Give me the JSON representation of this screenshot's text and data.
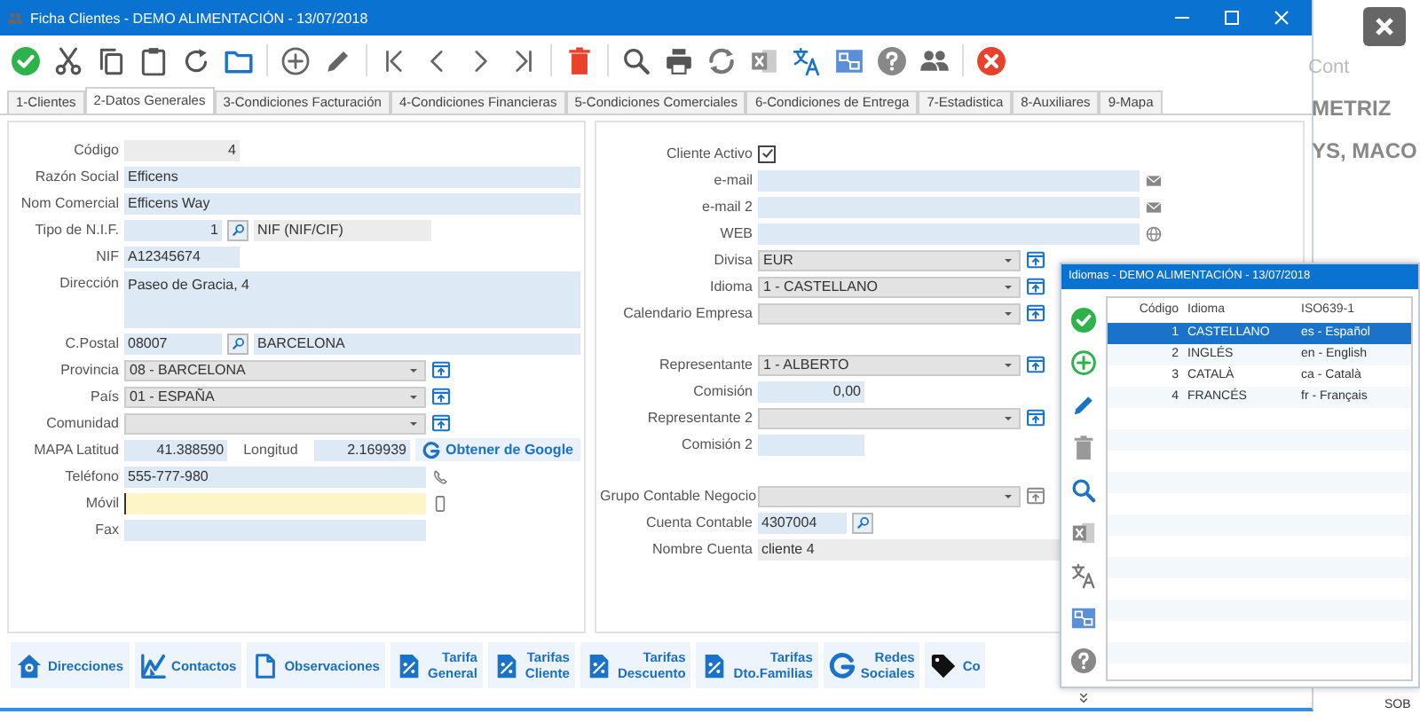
{
  "window": {
    "title": "Ficha Clientes - DEMO ALIMENTACIÓN - 13/07/2018"
  },
  "tabs": [
    {
      "label": "1-Clientes",
      "selected": false
    },
    {
      "label": "2-Datos Generales",
      "selected": true
    },
    {
      "label": "3-Condiciones Facturación",
      "selected": false
    },
    {
      "label": "4-Condiciones Financieras",
      "selected": false
    },
    {
      "label": "5-Condiciones Comerciales",
      "selected": false
    },
    {
      "label": "6-Condiciones de Entrega",
      "selected": false
    },
    {
      "label": "7-Estadistica",
      "selected": false
    },
    {
      "label": "8-Auxiliares",
      "selected": false
    },
    {
      "label": "9-Mapa",
      "selected": false
    }
  ],
  "general": {
    "codigo": {
      "label": "Código",
      "value": "4"
    },
    "razon_social": {
      "label": "Razón Social",
      "value": "Efficens"
    },
    "nom_comercial": {
      "label": "Nom Comercial",
      "value": "Efficens Way"
    },
    "tipo_nif": {
      "label": "Tipo de N.I.F.",
      "value": "1",
      "description": "NIF (NIF/CIF)"
    },
    "nif": {
      "label": "NIF",
      "value": "A12345674"
    },
    "direccion": {
      "label": "Dirección",
      "value": "Paseo de Gracia, 4"
    },
    "cpostal": {
      "label": "C.Postal",
      "value": "08007",
      "description": "BARCELONA"
    },
    "provincia": {
      "label": "Provincia",
      "value": "08 - BARCELONA"
    },
    "pais": {
      "label": "País",
      "value": "01 - ESPAÑA"
    },
    "comunidad": {
      "label": "Comunidad"
    },
    "latitud": {
      "label": "MAPA Latitud",
      "value": "41.388590"
    },
    "longitud": {
      "label": "Longitud",
      "value": "2.169939"
    },
    "google_link": "Obtener de Google",
    "telefono": {
      "label": "Teléfono",
      "value": "555-777-980"
    },
    "movil": {
      "label": "Móvil",
      "focused": true
    },
    "fax": {
      "label": "Fax"
    }
  },
  "commercial": {
    "cliente_activo": {
      "label": "Cliente Activo",
      "checked": true
    },
    "email": {
      "label": "e-mail"
    },
    "email2": {
      "label": "e-mail 2"
    },
    "web": {
      "label": "WEB"
    },
    "divisa": {
      "label": "Divisa",
      "value": "EUR"
    },
    "idioma": {
      "label": "Idioma",
      "value": "1 - CASTELLANO"
    },
    "calendario": {
      "label": "Calendario Empresa"
    },
    "representante": {
      "label": "Representante",
      "value": "1 - ALBERTO"
    },
    "comision": {
      "label": "Comisión",
      "value": "0,00"
    },
    "representante2": {
      "label": "Representante 2"
    },
    "comision2": {
      "label": "Comisión 2"
    },
    "grupo_contable": {
      "label": "Grupo Contable Negocio"
    },
    "cuenta_contable": {
      "label": "Cuenta Contable",
      "value": "4307004"
    },
    "nombre_cuenta": {
      "label": "Nombre Cuenta",
      "value": "cliente 4"
    }
  },
  "bottom_buttons": [
    {
      "lines": [
        "Direcciones"
      ]
    },
    {
      "lines": [
        "Contactos"
      ]
    },
    {
      "lines": [
        "Observaciones"
      ]
    },
    {
      "lines": [
        "Tarifa",
        "General"
      ]
    },
    {
      "lines": [
        "Tarifas",
        "Cliente"
      ]
    },
    {
      "lines": [
        "Tarifas",
        "Descuento"
      ]
    },
    {
      "lines": [
        "Tarifas",
        "Dto.Familias"
      ]
    },
    {
      "lines": [
        "Redes",
        "Sociales"
      ]
    },
    {
      "lines": [
        "Co"
      ]
    }
  ],
  "popup": {
    "title": "Idiomas - DEMO ALIMENTACIÓN - 13/07/2018",
    "columns": [
      "Código",
      "Idioma",
      "ISO639-1"
    ],
    "rows": [
      {
        "cells": [
          "1",
          "CASTELLANO",
          "es - Español"
        ],
        "selected": true
      },
      {
        "cells": [
          "2",
          "INGLÉS",
          "en - English"
        ],
        "selected": false
      },
      {
        "cells": [
          "3",
          "CATALÀ",
          "ca - Català"
        ],
        "selected": false
      },
      {
        "cells": [
          "4",
          "FRANCÉS",
          "fr - Français"
        ],
        "selected": false
      }
    ]
  },
  "background_app": {
    "texts": [
      "Cont",
      "METRIZ",
      "YS, MACO"
    ],
    "footer": "SOB"
  }
}
